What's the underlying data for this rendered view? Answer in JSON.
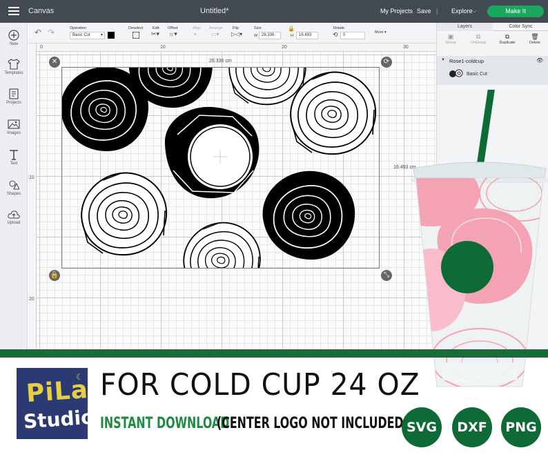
{
  "app": {
    "title": "Canvas",
    "document_title": "Untitled*"
  },
  "topbar": {
    "my_projects": "My Projects",
    "save": "Save",
    "separator": "|",
    "explore": "Explore",
    "make_it": "Make It"
  },
  "sidebar": {
    "items": [
      {
        "label": "New",
        "icon": "plus-circle-icon"
      },
      {
        "label": "Templates",
        "icon": "shirt-icon"
      },
      {
        "label": "Projects",
        "icon": "projects-icon"
      },
      {
        "label": "Images",
        "icon": "image-icon"
      },
      {
        "label": "Text",
        "icon": "text-icon"
      },
      {
        "label": "Shapes",
        "icon": "shapes-icon"
      },
      {
        "label": "Upload",
        "icon": "upload-icon"
      }
    ]
  },
  "toolbar": {
    "operation_label": "Operation",
    "operation_value": "Basic Cut",
    "deselect": "Deselect",
    "edit": "Edit",
    "offset": "Offset",
    "align": "Align",
    "arrange": "Arrange",
    "flip": "Flip",
    "size_label": "Size",
    "w_label": "W",
    "w_value": "26.336",
    "h_label": "H",
    "h_value": "16.493",
    "rotate_label": "Rotate",
    "rotate_value": "0",
    "more": "More ▾"
  },
  "canvas": {
    "ruler_top": [
      "0",
      "10",
      "20",
      "30"
    ],
    "ruler_left": [
      "10",
      "20"
    ],
    "width_label": "26.336 cm",
    "height_label": "16.493 cm"
  },
  "layers_panel": {
    "tabs": [
      "Layers",
      "Color Sync"
    ],
    "actions": [
      "Group",
      "UnGroup",
      "Duplicate",
      "Delete"
    ],
    "layer_name": "Rose1-coldcup",
    "layer_sub": "Basic Cut"
  },
  "banner": {
    "logo_line1": "PiLa",
    "logo_line2": "Studio",
    "headline": "FOR COLD CUP 24 OZ",
    "sub_highlight": "INSTANT DOWNLOAD",
    "sub_rest": "(CENTER LOGO NOT INCLUDED)",
    "formats": [
      "SVG",
      "DXF",
      "PNG"
    ]
  },
  "colors": {
    "topbar": "#434a54",
    "make_it": "#1aa85e",
    "banner_green": "#1b6b3a",
    "logo_bg": "#2b3a72",
    "logo_yellow": "#e8cf42",
    "cup_pink": "#f4a3b4",
    "straw": "#0f6b35"
  }
}
